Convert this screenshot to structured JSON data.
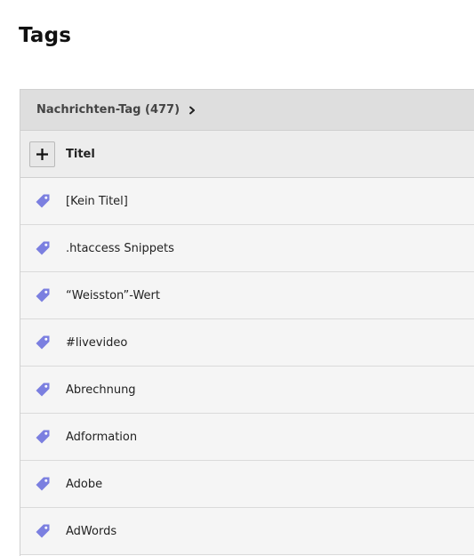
{
  "page": {
    "title": "Tags"
  },
  "panel": {
    "header_label": "Nachrichten-Tag (477)",
    "column_title": "Titel",
    "add_label": "+"
  },
  "rows": [
    {
      "label": "[Kein Titel]"
    },
    {
      "label": ".htaccess Snippets"
    },
    {
      "label": "“Weisston”-Wert"
    },
    {
      "label": "#livevideo"
    },
    {
      "label": "Abrechnung"
    },
    {
      "label": "Adformation"
    },
    {
      "label": "Adobe"
    },
    {
      "label": "AdWords"
    }
  ],
  "colors": {
    "tag_icon": "#7b7fe0",
    "header_bg": "#dedede",
    "row_bg": "#f5f5f5"
  },
  "icons": {
    "row_icon": "tag-icon",
    "header_icon": "chevron-right-icon"
  }
}
